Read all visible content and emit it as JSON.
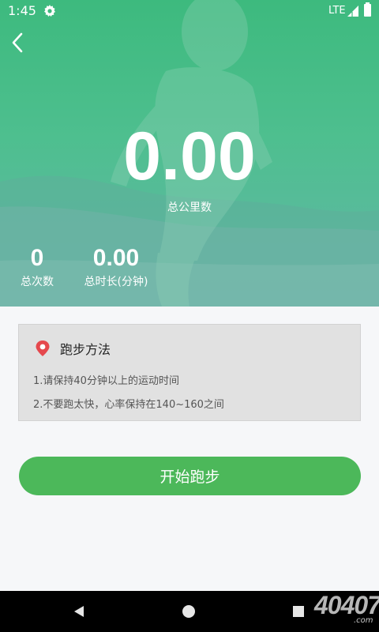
{
  "status_bar": {
    "time": "1:45",
    "network": "LTE"
  },
  "hero": {
    "total_km_value": "0.00",
    "total_km_label": "总公里数",
    "total_count_value": "0",
    "total_count_label": "总次数",
    "total_duration_value": "0.00",
    "total_duration_label": "总时长(分钟)"
  },
  "tips": {
    "title": "跑步方法",
    "items": [
      "1.请保持40分钟以上的运动时间",
      "2.不要跑太快，心率保持在140~160之间"
    ]
  },
  "actions": {
    "start_label": "开始跑步"
  },
  "watermark": {
    "text": "40407",
    "suffix": ".com"
  },
  "colors": {
    "accent": "#4cb85a",
    "hero_top": "#3dba7e",
    "marker": "#e5484d"
  },
  "icons": {
    "back": "chevron-left-icon",
    "settings": "gear-icon",
    "tips": "location-pin-icon"
  }
}
